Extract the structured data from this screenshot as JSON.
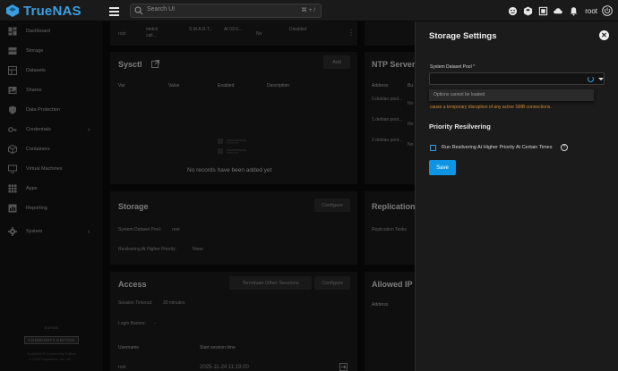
{
  "app": {
    "name": "TrueNAS"
  },
  "topbar": {
    "search_placeholder": "Search UI",
    "search_shortcut": "⌘ + /",
    "user": "root",
    "icons": [
      "feedback-icon",
      "truecommand-icon",
      "jobs-icon",
      "directory-services-icon",
      "notifications-icon",
      "power-icon"
    ]
  },
  "sidebar": {
    "items": [
      {
        "label": "Dashboard",
        "icon": "dashboard-icon"
      },
      {
        "label": "Storage",
        "icon": "storage-icon"
      },
      {
        "label": "Datasets",
        "icon": "datasets-icon"
      },
      {
        "label": "Shares",
        "icon": "shares-icon"
      },
      {
        "label": "Data Protection",
        "icon": "shield-icon"
      },
      {
        "label": "Credentials",
        "icon": "key-icon",
        "chevron": "›"
      },
      {
        "label": "Containers",
        "icon": "containers-icon"
      },
      {
        "label": "Virtual Machines",
        "icon": "vm-icon"
      },
      {
        "label": "Apps",
        "icon": "apps-icon"
      },
      {
        "label": "Reporting",
        "icon": "reporting-icon"
      },
      {
        "label": "System",
        "icon": "gear-icon",
        "chevron": "›"
      }
    ],
    "footer": {
      "small": "truenas",
      "badge": "COMMUNITY EDITION",
      "line1": "TrueNAS ® Community Edition",
      "line2": "© 2025 iXsystems, Inc. All ..."
    }
  },
  "main": {
    "top_row": {
      "c1": "root",
      "c2": "midclt call...",
      "c3": "S.M.A.R.T...",
      "c4": "At 03:0...",
      "c5": "No",
      "c6": "Disabled"
    },
    "sysctl": {
      "title": "Sysctl",
      "add": "Add",
      "columns": [
        "Var",
        "Value",
        "Enabled",
        "Description"
      ],
      "empty": "No records have been added yet"
    },
    "ntp": {
      "title": "NTP Servers",
      "columns": [
        "Address",
        "Bu"
      ],
      "rows": [
        "0.debian.pool...",
        "1.debian.pool...",
        "2.debian.pool..."
      ],
      "partial": [
        "No",
        "No",
        "No"
      ]
    },
    "storage": {
      "title": "Storage",
      "configure": "Configure",
      "line1": "System Dataset Pool:",
      "line1_value": "root",
      "line2": "Resilvering At Higher Priority:",
      "line2_value": "None"
    },
    "replication": {
      "title": "Replication",
      "text": "Replication Tasks"
    },
    "access": {
      "title": "Access",
      "terminate": "Terminate Other Sessions",
      "configure": "Configure",
      "timeout_label": "Session Timeout:",
      "timeout_value": "30 minutes",
      "banner_label": "Login Banner:",
      "banner_value": "-",
      "col_user": "Username",
      "col_start": "Start session time",
      "row_user": "root",
      "row_time": "2025-11-24 11:19:00"
    },
    "allowed_ip": {
      "title": "Allowed IP",
      "col": "Address"
    }
  },
  "panel": {
    "title": "Storage Settings",
    "field_label": "System Dataset Pool *",
    "dropdown_text": "Options cannot be loaded",
    "warning": "cause a temporary disruption of any active SMB connections.",
    "section_title": "Priority Resilvering",
    "checkbox_label": "Run Resilvering At Higher Priority At Certain Times",
    "save": "Save"
  },
  "colors": {
    "accent": "#0d95e3",
    "brand": "#3b9fe0",
    "warning": "#d08a2f"
  }
}
